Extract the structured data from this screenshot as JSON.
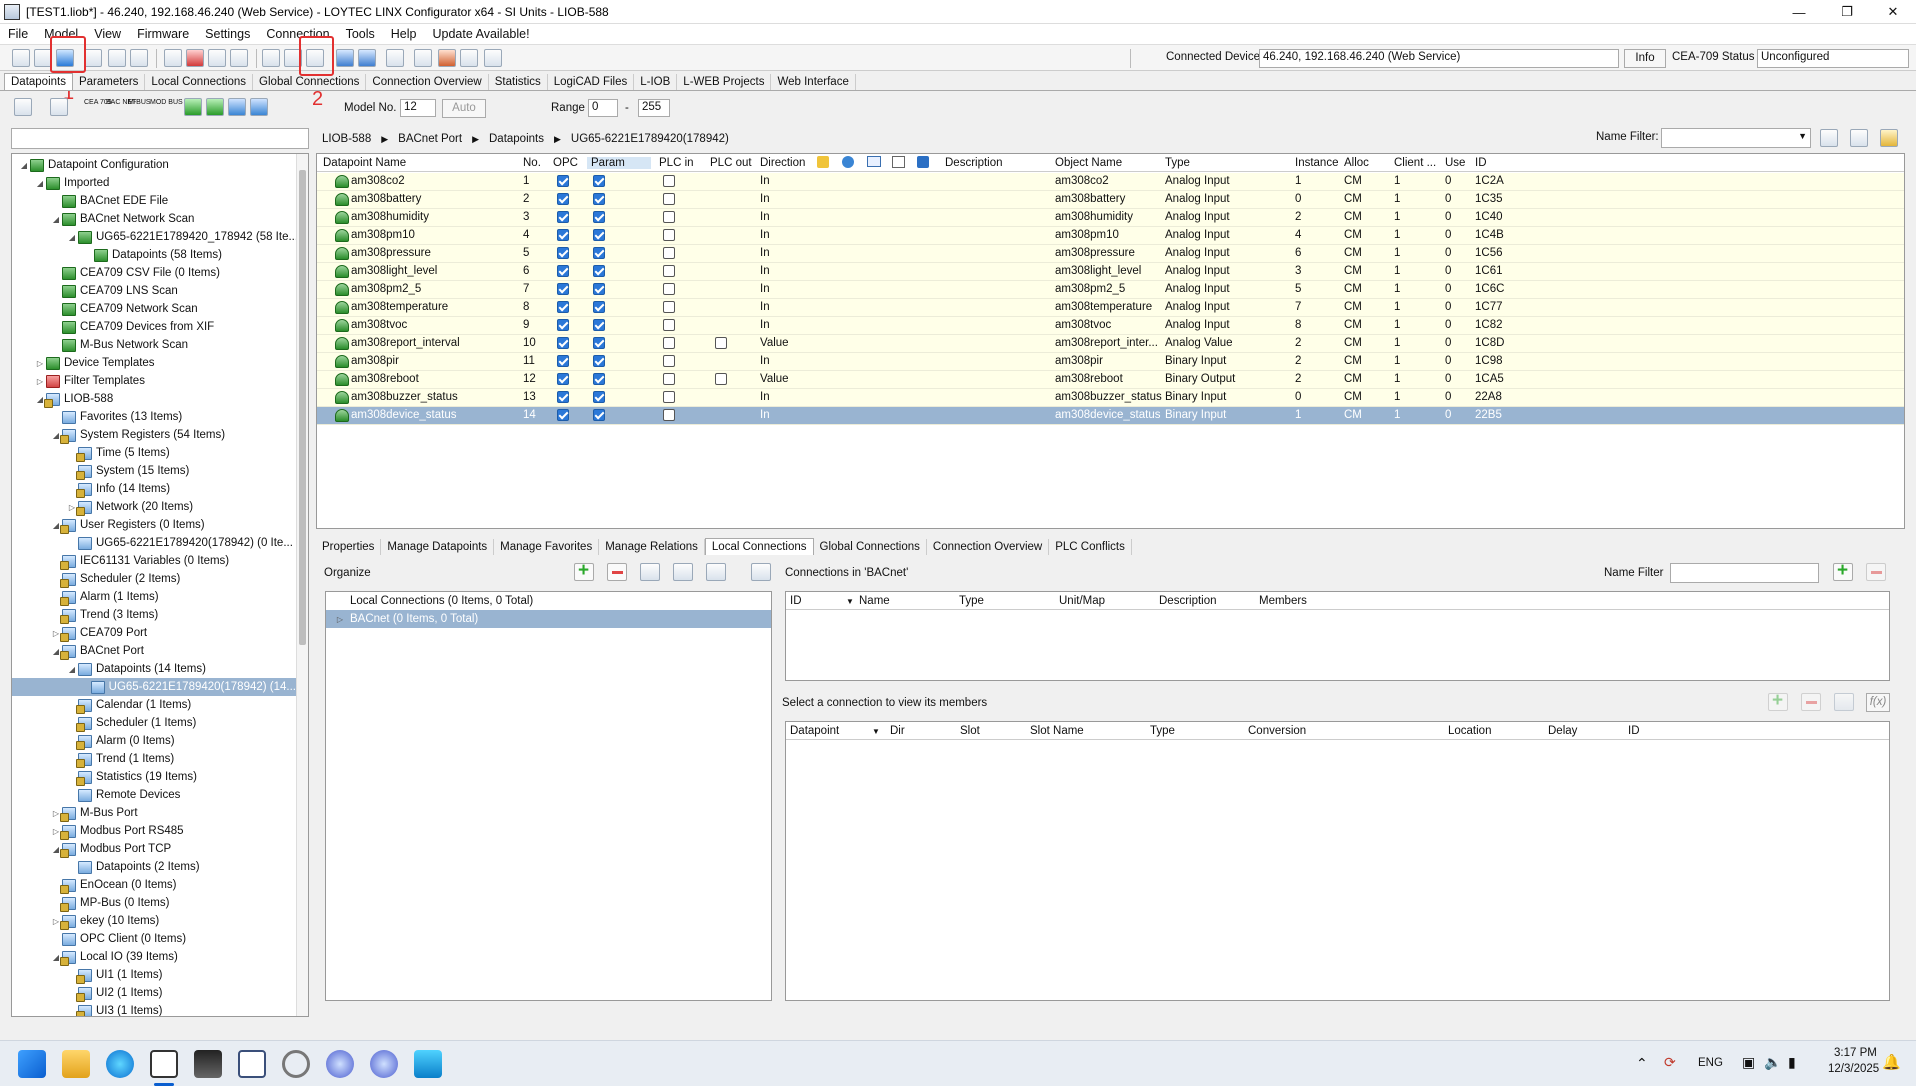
{
  "window": {
    "title": "[TEST1.liob*] - 46.240, 192.168.46.240 (Web Service) - LOYTEC LINX Configurator x64 - SI Units - LIOB-588"
  },
  "menu": [
    "File",
    "Model",
    "View",
    "Firmware",
    "Settings",
    "Connection",
    "Tools",
    "Help",
    "Update Available!"
  ],
  "connection": {
    "label": "Connected Device",
    "value": "46.240, 192.168.46.240 (Web Service)",
    "info_button": "Info",
    "status_label": "CEA-709 Status",
    "status_value": "Unconfigured"
  },
  "annotations": {
    "marker1": "1",
    "marker2": "2"
  },
  "main_tabs": [
    "Datapoints",
    "Parameters",
    "Local Connections",
    "Global Connections",
    "Connection Overview",
    "Statistics",
    "LogiCAD Files",
    "L-IOB",
    "L-WEB Projects",
    "Web Interface"
  ],
  "second_toolbar": {
    "model_no_label": "Model No.",
    "model_no_value": "12",
    "auto_button": "Auto",
    "range_label": "Range",
    "range_from": "0",
    "range_sep": "-",
    "range_to": "255",
    "icon_texts": [
      "CEA 709",
      "BAC NET",
      "M-BUS",
      "MOD BUS"
    ]
  },
  "breadcrumb": [
    "LIOB-588",
    "BACnet Port",
    "Datapoints",
    "UG65-6221E1789420(178942)"
  ],
  "name_filter_label": "Name Filter:",
  "tree": [
    {
      "label": "Datapoint Configuration",
      "level": 0,
      "toggle": "◢",
      "icon": "green"
    },
    {
      "label": "Imported",
      "level": 1,
      "toggle": "◢",
      "icon": "green"
    },
    {
      "label": "BACnet EDE File",
      "level": 2,
      "toggle": "",
      "icon": "green"
    },
    {
      "label": "BACnet Network Scan",
      "level": 2,
      "toggle": "◢",
      "icon": "green"
    },
    {
      "label": "UG65-6221E1789420_178942 (58 Ite...",
      "level": 3,
      "toggle": "◢",
      "icon": "green"
    },
    {
      "label": "Datapoints (58 Items)",
      "level": 4,
      "toggle": "",
      "icon": "green"
    },
    {
      "label": "CEA709 CSV File (0 Items)",
      "level": 2,
      "toggle": "",
      "icon": "green"
    },
    {
      "label": "CEA709 LNS Scan",
      "level": 2,
      "toggle": "",
      "icon": "green"
    },
    {
      "label": "CEA709 Network Scan",
      "level": 2,
      "toggle": "",
      "icon": "green"
    },
    {
      "label": "CEA709 Devices from XIF",
      "level": 2,
      "toggle": "",
      "icon": "green"
    },
    {
      "label": "M-Bus Network Scan",
      "level": 2,
      "toggle": "",
      "icon": "green"
    },
    {
      "label": "Device Templates",
      "level": 1,
      "toggle": "▷",
      "icon": "green"
    },
    {
      "label": "Filter Templates",
      "level": 1,
      "toggle": "▷",
      "icon": "red"
    },
    {
      "label": "LIOB-588",
      "level": 1,
      "toggle": "◢",
      "icon": "bluelock"
    },
    {
      "label": "Favorites (13 Items)",
      "level": 2,
      "toggle": "",
      "icon": "blue"
    },
    {
      "label": "System Registers (54 Items)",
      "level": 2,
      "toggle": "◢",
      "icon": "bluelock"
    },
    {
      "label": "Time (5 Items)",
      "level": 3,
      "toggle": "",
      "icon": "bluelock"
    },
    {
      "label": "System (15 Items)",
      "level": 3,
      "toggle": "",
      "icon": "bluelock"
    },
    {
      "label": "Info (14 Items)",
      "level": 3,
      "toggle": "",
      "icon": "bluelock"
    },
    {
      "label": "Network (20 Items)",
      "level": 3,
      "toggle": "▷",
      "icon": "bluelock"
    },
    {
      "label": "User Registers (0 Items)",
      "level": 2,
      "toggle": "◢",
      "icon": "bluelock"
    },
    {
      "label": "UG65-6221E1789420(178942) (0 Ite...",
      "level": 3,
      "toggle": "",
      "icon": "blue"
    },
    {
      "label": "IEC61131 Variables (0 Items)",
      "level": 2,
      "toggle": "",
      "icon": "bluelock"
    },
    {
      "label": "Scheduler (2 Items)",
      "level": 2,
      "toggle": "",
      "icon": "bluelock"
    },
    {
      "label": "Alarm (1 Items)",
      "level": 2,
      "toggle": "",
      "icon": "bluelock"
    },
    {
      "label": "Trend (3 Items)",
      "level": 2,
      "toggle": "",
      "icon": "bluelock"
    },
    {
      "label": "CEA709 Port",
      "level": 2,
      "toggle": "▷",
      "icon": "bluelock"
    },
    {
      "label": "BACnet Port",
      "level": 2,
      "toggle": "◢",
      "icon": "bluelock"
    },
    {
      "label": "Datapoints (14 Items)",
      "level": 3,
      "toggle": "◢",
      "icon": "blue"
    },
    {
      "label": "UG65-6221E1789420(178942) (14...",
      "level": 4,
      "toggle": "",
      "icon": "blue",
      "selected": true
    },
    {
      "label": "Calendar (1 Items)",
      "level": 3,
      "toggle": "",
      "icon": "bluelock"
    },
    {
      "label": "Scheduler (1 Items)",
      "level": 3,
      "toggle": "",
      "icon": "bluelock"
    },
    {
      "label": "Alarm (0 Items)",
      "level": 3,
      "toggle": "",
      "icon": "bluelock"
    },
    {
      "label": "Trend (1 Items)",
      "level": 3,
      "toggle": "",
      "icon": "bluelock"
    },
    {
      "label": "Statistics (19 Items)",
      "level": 3,
      "toggle": "",
      "icon": "bluelock"
    },
    {
      "label": "Remote Devices",
      "level": 3,
      "toggle": "",
      "icon": "blue"
    },
    {
      "label": "M-Bus Port",
      "level": 2,
      "toggle": "▷",
      "icon": "bluelock"
    },
    {
      "label": "Modbus Port RS485",
      "level": 2,
      "toggle": "▷",
      "icon": "bluelock"
    },
    {
      "label": "Modbus Port TCP",
      "level": 2,
      "toggle": "◢",
      "icon": "bluelock"
    },
    {
      "label": "Datapoints (2 Items)",
      "level": 3,
      "toggle": "",
      "icon": "blue"
    },
    {
      "label": "EnOcean (0 Items)",
      "level": 2,
      "toggle": "",
      "icon": "bluelock"
    },
    {
      "label": "MP-Bus (0 Items)",
      "level": 2,
      "toggle": "",
      "icon": "bluelock"
    },
    {
      "label": "ekey (10 Items)",
      "level": 2,
      "toggle": "▷",
      "icon": "bluelock"
    },
    {
      "label": "OPC Client (0 Items)",
      "level": 2,
      "toggle": "",
      "icon": "blue"
    },
    {
      "label": "Local IO (39 Items)",
      "level": 2,
      "toggle": "◢",
      "icon": "bluelock"
    },
    {
      "label": "UI1 (1 Items)",
      "level": 3,
      "toggle": "",
      "icon": "bluelock"
    },
    {
      "label": "UI2 (1 Items)",
      "level": 3,
      "toggle": "",
      "icon": "bluelock"
    },
    {
      "label": "UI3 (1 Items)",
      "level": 3,
      "toggle": "",
      "icon": "bluelock"
    }
  ],
  "grid": {
    "columns": [
      "Datapoint Name",
      "No.",
      "OPC",
      "Param",
      "PLC in",
      "PLC out",
      "Direction",
      "Description",
      "Object Name",
      "Type",
      "Instance",
      "Alloc",
      "Client ...",
      "Use",
      "ID"
    ],
    "rows": [
      {
        "name": "am308co2",
        "no": "1",
        "opc": true,
        "param": true,
        "plcin": false,
        "plcout": null,
        "direction": "In",
        "object": "am308co2",
        "type": "Analog Input",
        "instance": "1",
        "alloc": "CM",
        "client": "1",
        "use": "0",
        "id": "1C2A"
      },
      {
        "name": "am308battery",
        "no": "2",
        "opc": true,
        "param": true,
        "plcin": false,
        "plcout": null,
        "direction": "In",
        "object": "am308battery",
        "type": "Analog Input",
        "instance": "0",
        "alloc": "CM",
        "client": "1",
        "use": "0",
        "id": "1C35"
      },
      {
        "name": "am308humidity",
        "no": "3",
        "opc": true,
        "param": true,
        "plcin": false,
        "plcout": null,
        "direction": "In",
        "object": "am308humidity",
        "type": "Analog Input",
        "instance": "2",
        "alloc": "CM",
        "client": "1",
        "use": "0",
        "id": "1C40"
      },
      {
        "name": "am308pm10",
        "no": "4",
        "opc": true,
        "param": true,
        "plcin": false,
        "plcout": null,
        "direction": "In",
        "object": "am308pm10",
        "type": "Analog Input",
        "instance": "4",
        "alloc": "CM",
        "client": "1",
        "use": "0",
        "id": "1C4B"
      },
      {
        "name": "am308pressure",
        "no": "5",
        "opc": true,
        "param": true,
        "plcin": false,
        "plcout": null,
        "direction": "In",
        "object": "am308pressure",
        "type": "Analog Input",
        "instance": "6",
        "alloc": "CM",
        "client": "1",
        "use": "0",
        "id": "1C56"
      },
      {
        "name": "am308light_level",
        "no": "6",
        "opc": true,
        "param": true,
        "plcin": false,
        "plcout": null,
        "direction": "In",
        "object": "am308light_level",
        "type": "Analog Input",
        "instance": "3",
        "alloc": "CM",
        "client": "1",
        "use": "0",
        "id": "1C61"
      },
      {
        "name": "am308pm2_5",
        "no": "7",
        "opc": true,
        "param": true,
        "plcin": false,
        "plcout": null,
        "direction": "In",
        "object": "am308pm2_5",
        "type": "Analog Input",
        "instance": "5",
        "alloc": "CM",
        "client": "1",
        "use": "0",
        "id": "1C6C"
      },
      {
        "name": "am308temperature",
        "no": "8",
        "opc": true,
        "param": true,
        "plcin": false,
        "plcout": null,
        "direction": "In",
        "object": "am308temperature",
        "type": "Analog Input",
        "instance": "7",
        "alloc": "CM",
        "client": "1",
        "use": "0",
        "id": "1C77"
      },
      {
        "name": "am308tvoc",
        "no": "9",
        "opc": true,
        "param": true,
        "plcin": false,
        "plcout": null,
        "direction": "In",
        "object": "am308tvoc",
        "type": "Analog Input",
        "instance": "8",
        "alloc": "CM",
        "client": "1",
        "use": "0",
        "id": "1C82"
      },
      {
        "name": "am308report_interval",
        "no": "10",
        "opc": true,
        "param": true,
        "plcin": false,
        "plcout": false,
        "direction": "Value",
        "object": "am308report_inter...",
        "type": "Analog Value",
        "instance": "2",
        "alloc": "CM",
        "client": "1",
        "use": "0",
        "id": "1C8D"
      },
      {
        "name": "am308pir",
        "no": "11",
        "opc": true,
        "param": true,
        "plcin": false,
        "plcout": null,
        "direction": "In",
        "object": "am308pir",
        "type": "Binary Input",
        "instance": "2",
        "alloc": "CM",
        "client": "1",
        "use": "0",
        "id": "1C98"
      },
      {
        "name": "am308reboot",
        "no": "12",
        "opc": true,
        "param": true,
        "plcin": false,
        "plcout": false,
        "direction": "Value",
        "object": "am308reboot",
        "type": "Binary Output",
        "instance": "2",
        "alloc": "CM",
        "client": "1",
        "use": "0",
        "id": "1CA5"
      },
      {
        "name": "am308buzzer_status",
        "no": "13",
        "opc": true,
        "param": true,
        "plcin": false,
        "plcout": null,
        "direction": "In",
        "object": "am308buzzer_status",
        "type": "Binary Input",
        "instance": "0",
        "alloc": "CM",
        "client": "1",
        "use": "0",
        "id": "22A8"
      },
      {
        "name": "am308device_status",
        "no": "14",
        "opc": true,
        "param": true,
        "plcin": false,
        "plcout": null,
        "direction": "In",
        "object": "am308device_status",
        "type": "Binary Input",
        "instance": "1",
        "alloc": "CM",
        "client": "1",
        "use": "0",
        "id": "22B5",
        "selected": true
      }
    ]
  },
  "bottom_tabs": [
    "Properties",
    "Manage Datapoints",
    "Manage Favorites",
    "Manage Relations",
    "Local Connections",
    "Global Connections",
    "Connection Overview",
    "PLC Conflicts"
  ],
  "organize": {
    "label": "Organize",
    "items": [
      {
        "label": "Local Connections (0 Items, 0 Total)"
      },
      {
        "label": "BACnet (0 Items, 0 Total)",
        "selected": true
      }
    ]
  },
  "connections": {
    "title": "Connections in 'BACnet'",
    "name_filter": "Name Filter",
    "columns": [
      "ID",
      "Name",
      "Type",
      "Unit/Map",
      "Description",
      "Members"
    ],
    "members_hint": "Select a connection to view its members",
    "member_columns": [
      "Datapoint",
      "Dir",
      "Slot",
      "Slot Name",
      "Type",
      "Conversion",
      "Location",
      "Delay",
      "ID"
    ],
    "fx_label": "f(x)"
  },
  "taskbar": {
    "lang": "ENG",
    "time": "3:17 PM",
    "date": "12/3/2025"
  },
  "colors": {
    "row_bg": "#ffffe8",
    "selected_bg": "#99b4d1",
    "annotation": "#e23030",
    "check_on": "#2b78d8"
  }
}
